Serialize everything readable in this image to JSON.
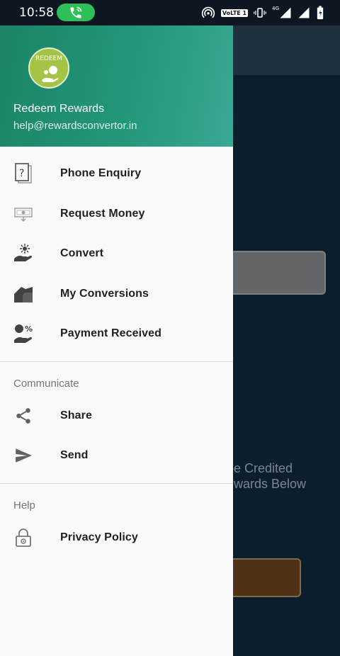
{
  "status_bar": {
    "time": "10:58",
    "call_icon": "phone-call-icon",
    "volte": "VoLTE 1",
    "network": "4G"
  },
  "header": {
    "logo_text": "REDEEM",
    "app_name": "Redeem Rewards",
    "email": "help@rewardsconvertor.in",
    "gradient_colors": [
      "#1c8466",
      "#3aa894"
    ]
  },
  "menu_primary": [
    {
      "label": "Phone Enquiry",
      "icon": "phone-enquiry-icon"
    },
    {
      "label": "Request Money",
      "icon": "money-note-icon"
    },
    {
      "label": "Convert",
      "icon": "convert-hand-icon"
    },
    {
      "label": "My Conversions",
      "icon": "house-icon"
    },
    {
      "label": "Payment Received",
      "icon": "payment-received-icon"
    }
  ],
  "section_communicate": {
    "title": "Communicate",
    "items": [
      {
        "label": "Share",
        "icon": "share-icon"
      },
      {
        "label": "Send",
        "icon": "send-icon"
      }
    ]
  },
  "section_help": {
    "title": "Help",
    "items": [
      {
        "label": "Privacy Policy",
        "icon": "lock-icon"
      }
    ]
  },
  "background": {
    "partial_text": "be Credited ewards Below"
  },
  "colors": {
    "accent": "#23977a",
    "drawer_bg": "#fafafa",
    "app_bg": "#0c1d2c",
    "call_pill": "#2fbf59"
  }
}
